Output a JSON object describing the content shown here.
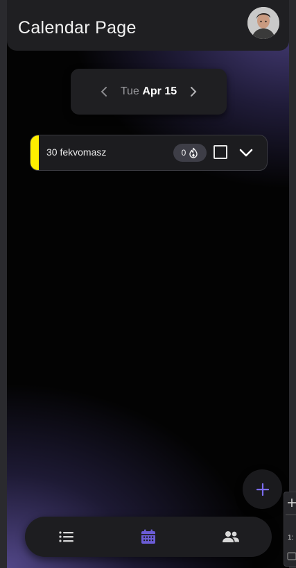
{
  "header": {
    "title": "Calendar Page"
  },
  "date_picker": {
    "weekday": "Tue",
    "date": "Apr 15"
  },
  "tasks": [
    {
      "name": "30 fekvomasz",
      "streak": "0",
      "accent_color": "#ffee00",
      "checked": false
    }
  ],
  "bottom_nav": {
    "items": [
      {
        "icon": "list-icon",
        "active": false
      },
      {
        "icon": "calendar-icon",
        "active": true
      },
      {
        "icon": "people-icon",
        "active": false
      }
    ],
    "active_color": "#6b5cd6"
  },
  "fab": {
    "icon": "plus-icon",
    "color": "#7b6cf0"
  },
  "side_panel": {
    "label": "1:"
  }
}
